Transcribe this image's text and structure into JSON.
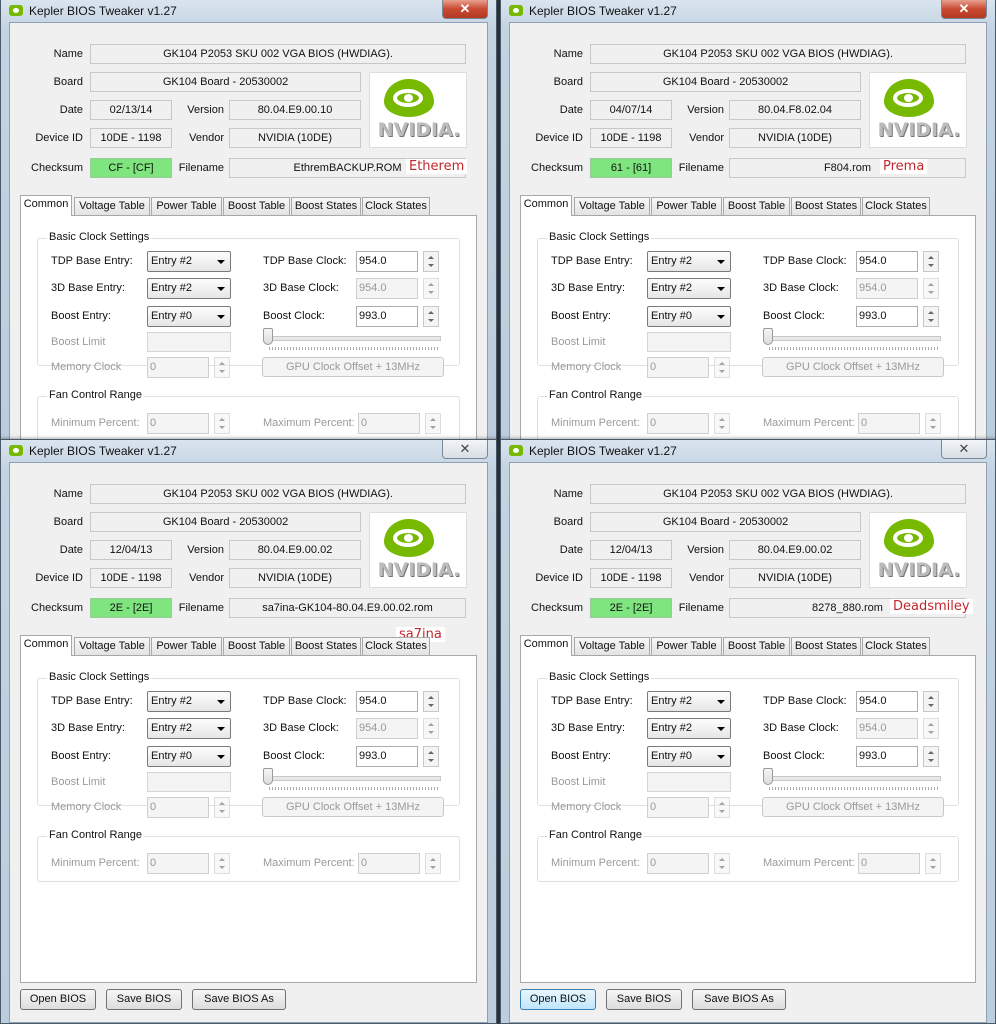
{
  "app": {
    "title": "Kepler BIOS Tweaker v1.27"
  },
  "labels": {
    "name": "Name",
    "board": "Board",
    "date": "Date",
    "version": "Version",
    "device_id": "Device ID",
    "vendor": "Vendor",
    "checksum": "Checksum",
    "filename": "Filename",
    "logo": "NVIDIA.",
    "basic_clock": "Basic Clock Settings",
    "tdp_entry": "TDP Base Entry:",
    "d3_entry": "3D Base Entry:",
    "boost_entry": "Boost Entry:",
    "tdp_clock": "TDP Base Clock:",
    "d3_clock": "3D Base Clock:",
    "boost_clock": "Boost Clock:",
    "boost_limit": "Boost Limit",
    "memory_clock": "Memory Clock",
    "gpu_offset": "GPU Clock Offset + 13MHz",
    "fan_range": "Fan Control Range",
    "min_percent": "Minimum Percent:",
    "max_percent": "Maximum Percent:"
  },
  "tabs": [
    "Common",
    "Voltage Table",
    "Power Table",
    "Boost Table",
    "Boost States",
    "Clock States"
  ],
  "buttons": {
    "open": "Open BIOS",
    "save": "Save BIOS",
    "save_as": "Save BIOS As"
  },
  "windows": [
    {
      "bios_name": "GK104 P2053 SKU 002 VGA BIOS (HWDIAG).",
      "board": "GK104 Board - 20530002",
      "date": "02/13/14",
      "version": "80.04.E9.00.10",
      "device_id": "10DE - 1198",
      "vendor": "NVIDIA (10DE)",
      "checksum": "CF - [CF]",
      "filename": "EthremBACKUP.ROM",
      "note": "Etherem",
      "tdp_entry": "Entry #2",
      "d3_entry": "Entry #2",
      "boost_entry": "Entry #0",
      "tdp_clock": "954.0",
      "d3_clock": "954.0",
      "boost_clock": "993.0",
      "memory_clock": "0",
      "min_percent": "0",
      "max_percent": "0"
    },
    {
      "bios_name": "GK104 P2053 SKU 002 VGA BIOS (HWDIAG).",
      "board": "GK104 Board - 20530002",
      "date": "04/07/14",
      "version": "80.04.F8.02.04",
      "device_id": "10DE - 1198",
      "vendor": "NVIDIA (10DE)",
      "checksum": "61 - [61]",
      "filename": "F804.rom",
      "note": "Prema",
      "tdp_entry": "Entry #2",
      "d3_entry": "Entry #2",
      "boost_entry": "Entry #0",
      "tdp_clock": "954.0",
      "d3_clock": "954.0",
      "boost_clock": "993.0",
      "memory_clock": "0",
      "min_percent": "0",
      "max_percent": "0"
    },
    {
      "bios_name": "GK104 P2053 SKU 002 VGA BIOS (HWDIAG).",
      "board": "GK104 Board - 20530002",
      "date": "12/04/13",
      "version": "80.04.E9.00.02",
      "device_id": "10DE - 1198",
      "vendor": "NVIDIA (10DE)",
      "checksum": "2E - [2E]",
      "filename": "sa7ina-GK104-80.04.E9.00.02.rom",
      "note": "sa7ina",
      "tdp_entry": "Entry #2",
      "d3_entry": "Entry #2",
      "boost_entry": "Entry #0",
      "tdp_clock": "954.0",
      "d3_clock": "954.0",
      "boost_clock": "993.0",
      "memory_clock": "0",
      "min_percent": "0",
      "max_percent": "0"
    },
    {
      "bios_name": "GK104 P2053 SKU 002 VGA BIOS (HWDIAG).",
      "board": "GK104 Board - 20530002",
      "date": "12/04/13",
      "version": "80.04.E9.00.02",
      "device_id": "10DE - 1198",
      "vendor": "NVIDIA (10DE)",
      "checksum": "2E - [2E]",
      "filename": "8278_880.rom",
      "note": "Deadsmiley",
      "tdp_entry": "Entry #2",
      "d3_entry": "Entry #2",
      "boost_entry": "Entry #0",
      "tdp_clock": "954.0",
      "d3_clock": "954.0",
      "boost_clock": "993.0",
      "memory_clock": "0",
      "min_percent": "0",
      "max_percent": "0"
    }
  ]
}
